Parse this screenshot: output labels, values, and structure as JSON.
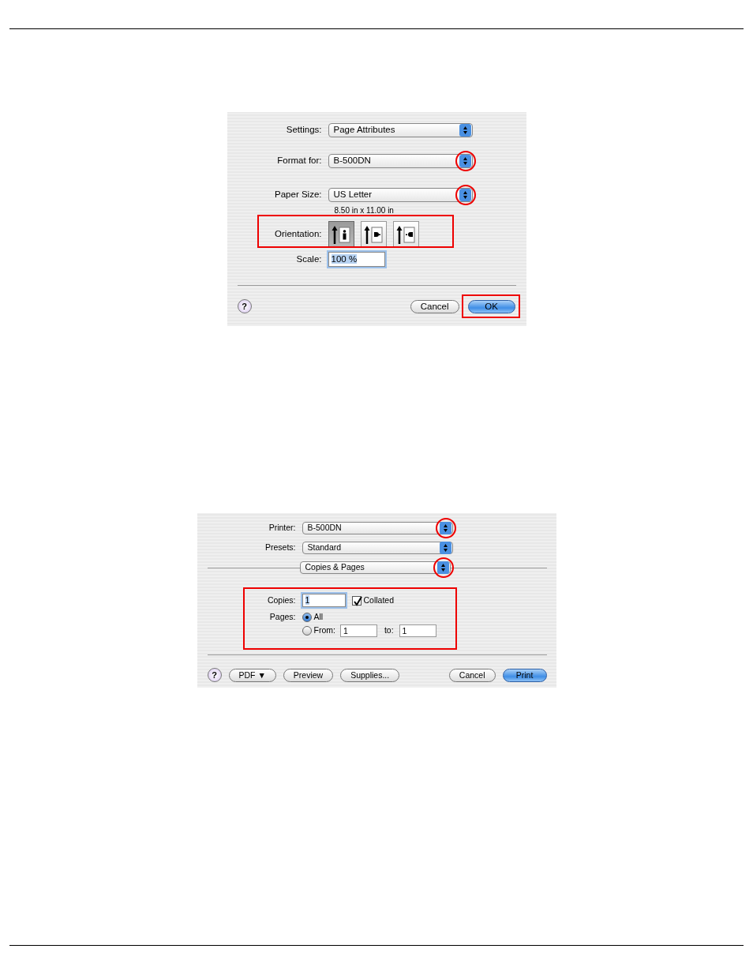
{
  "page_setup": {
    "rows": [
      {
        "kind": "select",
        "label": "Settings:",
        "value": "Page Attributes",
        "annotated": false
      },
      {
        "kind": "select",
        "label": "Format for:",
        "value": "B-500DN",
        "annotated": true
      },
      {
        "kind": "select",
        "label": "Paper Size:",
        "value": "US Letter",
        "annotated": true,
        "note": "8.50 in x 11.00 in"
      }
    ],
    "orientation": {
      "label": "Orientation:",
      "highlighted": true,
      "options": [
        {
          "kind": "portrait",
          "selected": true
        },
        {
          "kind": "landscape",
          "selected": false
        },
        {
          "kind": "landscape-reverse",
          "selected": false
        }
      ]
    },
    "scale": {
      "label": "Scale:",
      "value": "100 %"
    },
    "help": "?",
    "buttons": [
      {
        "label": "Cancel",
        "default": false,
        "highlighted": false
      },
      {
        "label": "OK",
        "default": true,
        "highlighted": true
      }
    ]
  },
  "print": {
    "rows": [
      {
        "kind": "select",
        "label": "Printer:",
        "value": "B-500DN",
        "annotated": true
      },
      {
        "kind": "select",
        "label": "Presets:",
        "value": "Standard",
        "annotated": false
      }
    ],
    "pane": {
      "value": "Copies & Pages",
      "annotated": true
    },
    "options_highlighted": true,
    "copies": {
      "label": "Copies:",
      "value": "1"
    },
    "collated": {
      "label": "Collated",
      "checked": true
    },
    "pages": {
      "label": "Pages:",
      "radios": [
        {
          "label": "All",
          "selected": true
        },
        {
          "label": "From:",
          "selected": false
        }
      ],
      "from": "1",
      "to_label": "to:",
      "to": "1"
    },
    "help": "?",
    "left_buttons": [
      "PDF ▼",
      "Preview",
      "Supplies..."
    ],
    "buttons": [
      {
        "label": "Cancel",
        "default": false
      },
      {
        "label": "Print",
        "default": true
      }
    ]
  }
}
